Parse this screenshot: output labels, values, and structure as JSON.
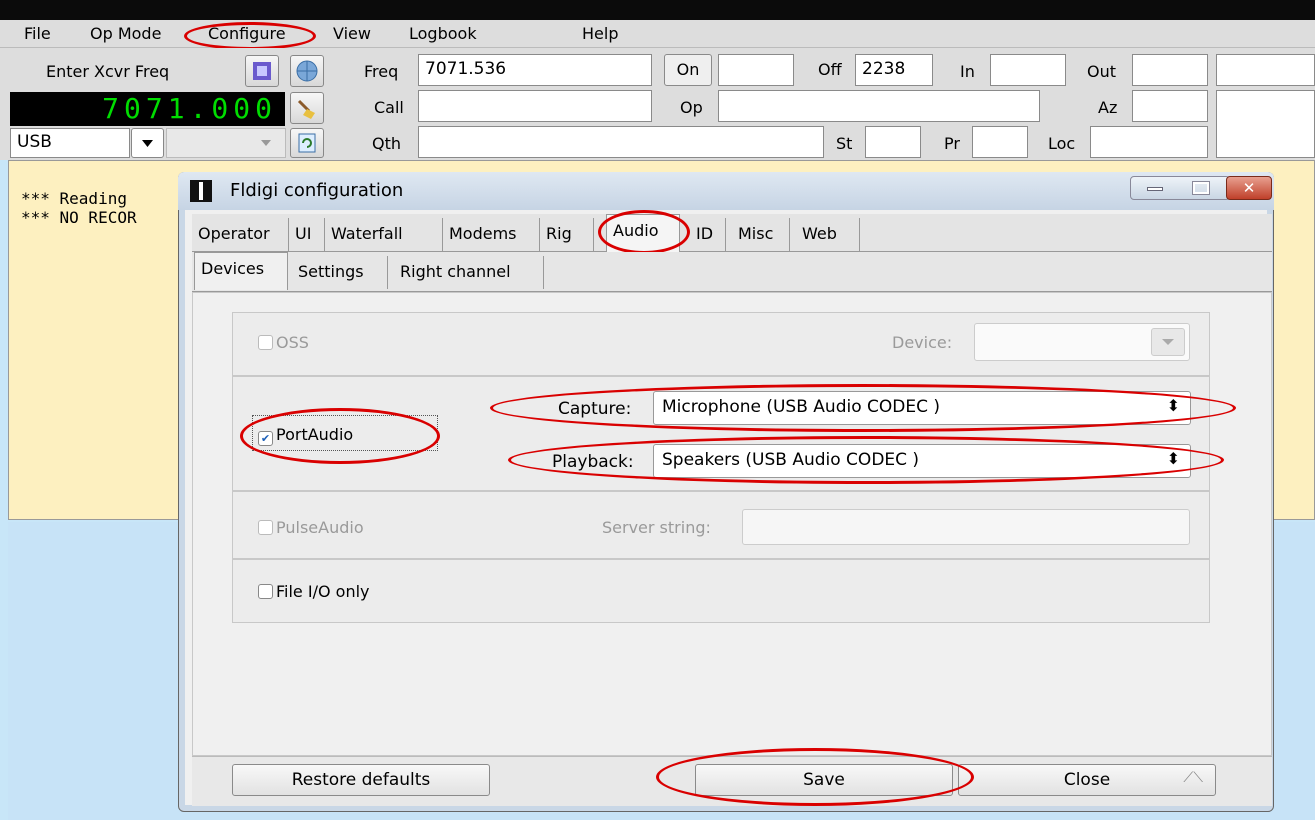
{
  "menu": {
    "file": "File",
    "op_mode": "Op Mode",
    "configure": "Configure",
    "view": "View",
    "logbook": "Logbook",
    "help": "Help"
  },
  "toolbar": {
    "enter_xcvr_freq": "Enter Xcvr Freq",
    "freq_display": "7071.000",
    "mode_value": "USB",
    "freq_label": "Freq",
    "freq_value": "7071.536",
    "on_label": "On",
    "off_label": "Off",
    "off_value": "2238",
    "in_label": "In",
    "out_label": "Out",
    "call_label": "Call",
    "op_label": "Op",
    "az_label": "Az",
    "qth_label": "Qth",
    "st_label": "St",
    "pr_label": "Pr",
    "loc_label": "Loc"
  },
  "log": {
    "line1": "*** Reading",
    "line2": "*** NO RECOR"
  },
  "dialog": {
    "title": "Fldigi configuration",
    "tabs": [
      "Operator",
      "UI",
      "Waterfall",
      "Modems",
      "Rig",
      "Audio",
      "ID",
      "Misc",
      "Web"
    ],
    "subtabs": [
      "Devices",
      "Settings",
      "Right channel"
    ],
    "oss_label": "OSS",
    "device_label": "Device:",
    "portaudio_label": "PortAudio",
    "capture_label": "Capture:",
    "capture_value": "Microphone (USB Audio CODEC )",
    "playback_label": "Playback:",
    "playback_value": "Speakers (USB Audio CODEC )",
    "pulseaudio_label": "PulseAudio",
    "server_string_label": "Server string:",
    "file_io_label": "File I/O only",
    "restore_defaults": "Restore defaults",
    "save": "Save",
    "close": "Close"
  },
  "colors": {
    "highlight_ring": "#d90000",
    "freq_led": "#00dd00",
    "log_background": "#fdf0c0"
  }
}
